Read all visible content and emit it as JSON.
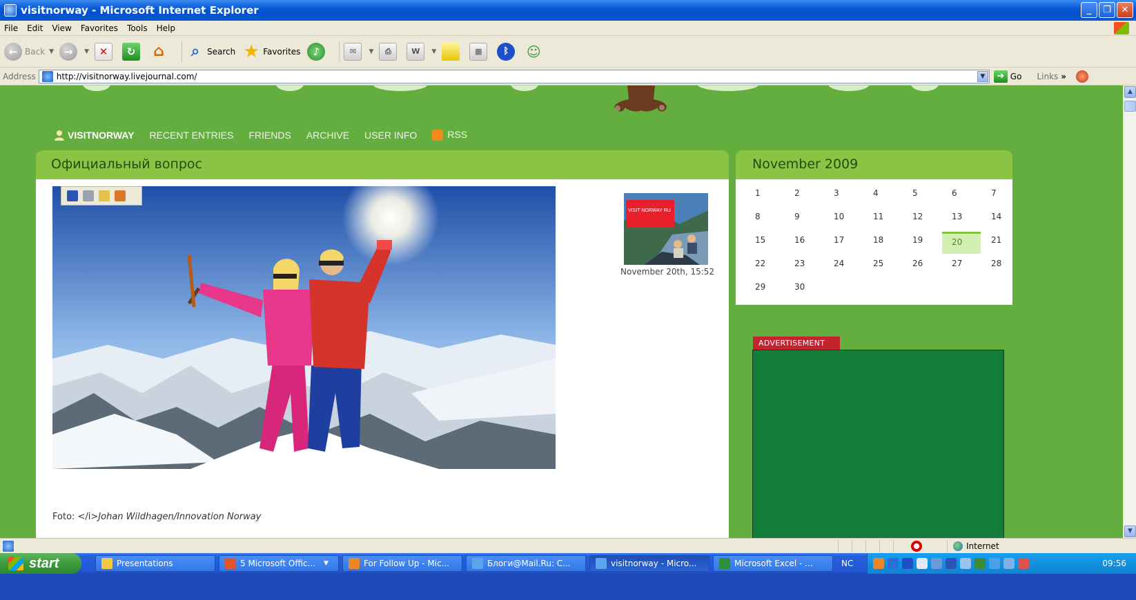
{
  "window": {
    "title": "visitnorway - Microsoft Internet Explorer",
    "buttons": [
      "_",
      "❐",
      "✕"
    ]
  },
  "menu": [
    "File",
    "Edit",
    "View",
    "Favorites",
    "Tools",
    "Help"
  ],
  "toolbar": {
    "back": "Back",
    "search": "Search",
    "favorites": "Favorites"
  },
  "address": {
    "label": "Address",
    "url": "http://visitnorway.livejournal.com/",
    "go": "Go",
    "links": "Links",
    "links_chevron": "»"
  },
  "nav": {
    "user": "VISITNORWAY",
    "items": [
      "RECENT ENTRIES",
      "FRIENDS",
      "ARCHIVE",
      "USER INFO",
      "RSS"
    ]
  },
  "entry": {
    "title": "Официальный вопрос",
    "date": "November 20th, 15:52",
    "caption_prefix": "Foto: </i>",
    "caption_name": "Johan Wildhagen/Innovation Norway",
    "userpic_badge": "VISIT NORWAY RU"
  },
  "calendar": {
    "title": "November 2009",
    "days": [
      "1",
      "2",
      "3",
      "4",
      "5",
      "6",
      "7",
      "8",
      "9",
      "10",
      "11",
      "12",
      "13",
      "14",
      "15",
      "16",
      "17",
      "18",
      "19",
      "20",
      "21",
      "22",
      "23",
      "24",
      "25",
      "26",
      "27",
      "28",
      "29",
      "30"
    ],
    "highlighted_day": "20"
  },
  "ad": {
    "label": "ADVERTISEMENT",
    "color": "#137c38"
  },
  "statusbar": {
    "zone": "Internet"
  },
  "taskbar": {
    "start": "start",
    "tasks": [
      "Presentations",
      "5 Microsoft Offic...",
      "For Follow Up - Mic...",
      "Блоги@Mail.Ru: C...",
      "visitnorway - Micro...",
      "Microsoft Excel - ..."
    ],
    "nc": "NC",
    "clock": "09:56"
  },
  "colors": {
    "page_bg": "#63ae3e",
    "header_green": "#89c444",
    "today_bg": "#d3f0b4",
    "ad_label": "#c3232f"
  }
}
